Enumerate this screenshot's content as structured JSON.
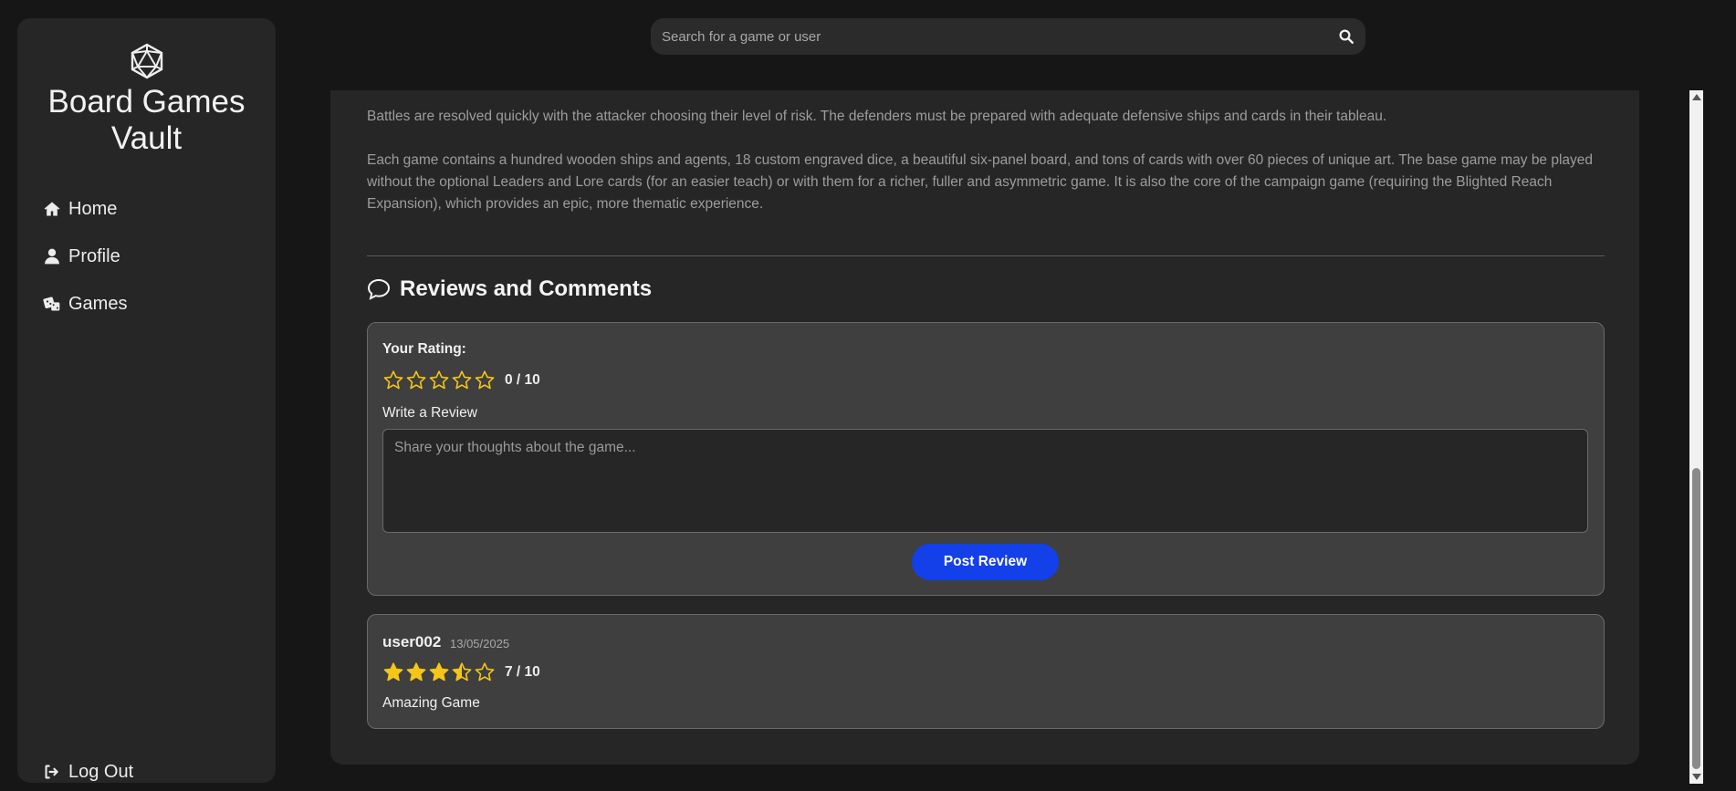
{
  "sidebar": {
    "brand": "Board Games Vault",
    "nav": {
      "home": "Home",
      "profile": "Profile",
      "games": "Games",
      "logout": "Log Out"
    }
  },
  "search": {
    "placeholder": "Search for a game or user"
  },
  "game": {
    "description": [
      "Battles are resolved quickly with the attacker choosing their level of risk. The defenders must be prepared with adequate defensive ships and cards in their tableau.",
      "Each game contains a hundred wooden ships and agents, 18 custom engraved dice, a beautiful six-panel board, and tons of cards with over 60 pieces of unique art. The base game may be played without the optional Leaders and Lore cards (for an easier teach) or with them for a richer, fuller and asymmetric game. It is also the core of the campaign game (requiring the Blighted Reach Expansion), which provides an epic, more thematic experience."
    ]
  },
  "reviews": {
    "title": "Reviews and Comments",
    "form": {
      "rating_label": "Your Rating:",
      "rating_value": 0,
      "rating_text": "0 / 10",
      "review_label": "Write a Review",
      "review_placeholder": "Share your thoughts about the game...",
      "submit_label": "Post Review"
    },
    "items": [
      {
        "user": "user002",
        "date": "13/05/2025",
        "rating_value": 7,
        "rating_text": "7 / 10",
        "text": "Amazing Game"
      }
    ]
  },
  "colors": {
    "star": "#f5c518",
    "accent": "#1340e8"
  },
  "icons": {
    "logo": "d20-dice-icon",
    "home": "home-icon",
    "profile": "user-icon",
    "games": "dice-icon",
    "logout": "logout-icon",
    "search": "search-icon",
    "comment": "comment-icon",
    "star": "star-icon"
  }
}
